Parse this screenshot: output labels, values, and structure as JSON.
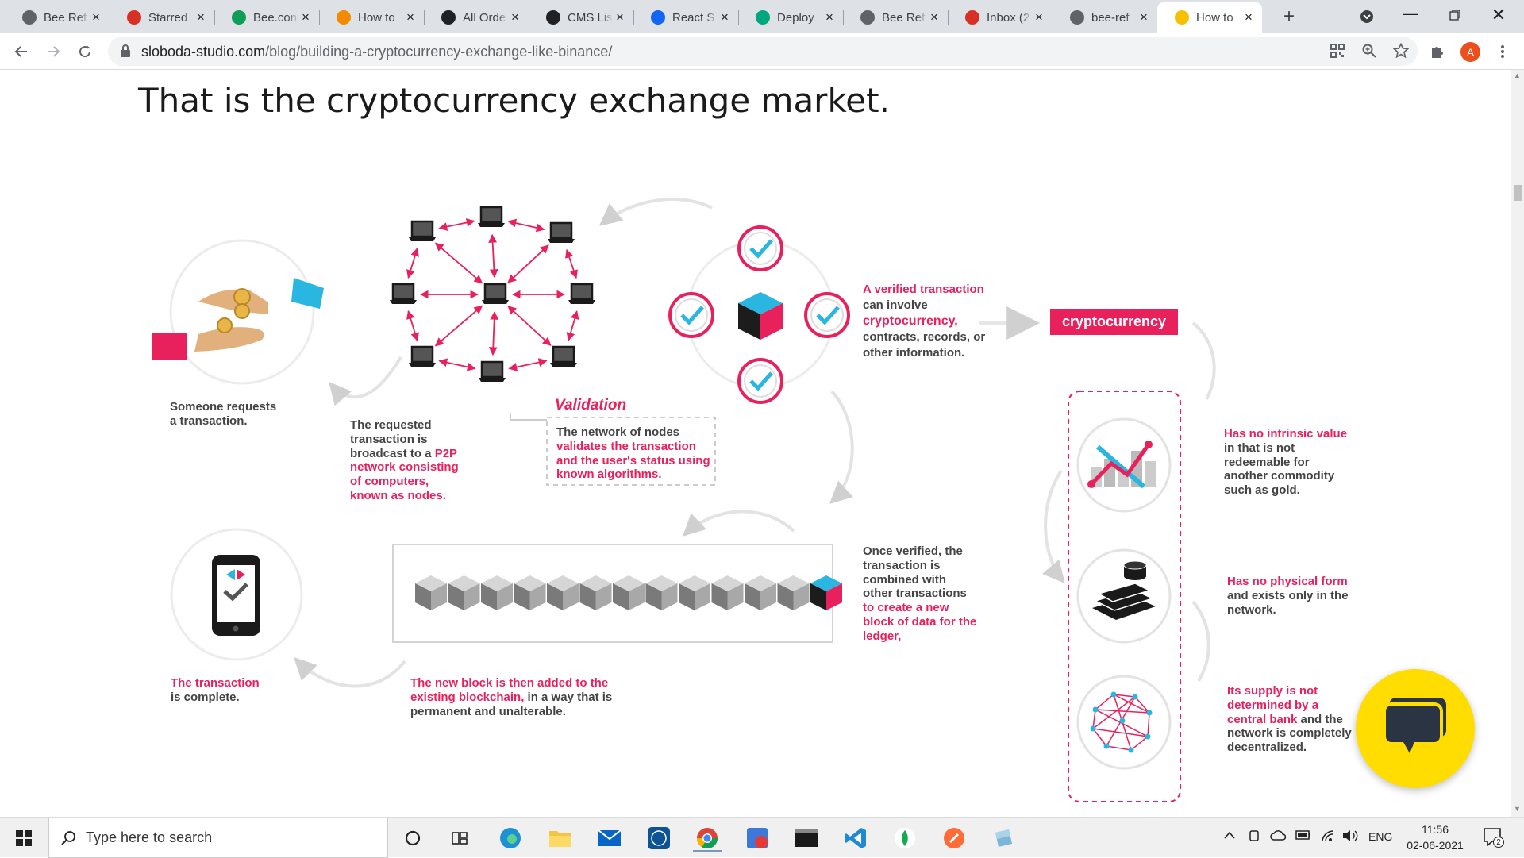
{
  "browser": {
    "tabs": [
      {
        "label": "Bee Ref",
        "icon": "bee-refer-icon",
        "color": "#5f6368"
      },
      {
        "label": "Starred",
        "icon": "gmail-icon",
        "color": "#d93025"
      },
      {
        "label": "Bee.con",
        "icon": "sheets-icon",
        "color": "#0f9d58"
      },
      {
        "label": "How to",
        "icon": "blog-icon",
        "color": "#f28b00"
      },
      {
        "label": "All Orde",
        "icon": "shopify-icon",
        "color": "#202124"
      },
      {
        "label": "CMS Lis",
        "icon": "cms-icon",
        "color": "#202124"
      },
      {
        "label": "React S",
        "icon": "mdb-icon",
        "color": "#1266f1"
      },
      {
        "label": "Deploy",
        "icon": "deploy-icon",
        "color": "#00a67e"
      },
      {
        "label": "Bee Ref",
        "icon": "bee-refer-icon",
        "color": "#5f6368"
      },
      {
        "label": "Inbox (2",
        "icon": "gmail-icon",
        "color": "#d93025"
      },
      {
        "label": "bee-ref",
        "icon": "globe-icon",
        "color": "#5f6368"
      },
      {
        "label": "How to",
        "icon": "sloboda-icon",
        "color": "#f6c000"
      }
    ],
    "active_tab_index": 11,
    "url_domain": "sloboda-studio.com",
    "url_path": "/blog/building-a-cryptocurrency-exchange-like-binance/",
    "profile_initial": "A"
  },
  "page": {
    "heading": "That is the cryptocurrency exchange market.",
    "step1": "Someone requests a transaction.",
    "step2_pre": "The requested transaction is broadcast to a ",
    "step2_pink": "P2P network consisting of computers, known as nodes.",
    "validation_title": "Validation",
    "validation_pre": "The network of nodes ",
    "validation_pink": "validates the transaction and the user's status using known algorithms.",
    "verified_pink": "A verified transaction",
    "verified_mid": "can involve",
    "verified_pink2": "cryptocurrency,",
    "verified_post": "contracts, records, or other information.",
    "crypto_label": "cryptocurrency",
    "once_pre": "Once verified, the transaction is combined with other transactions ",
    "once_pink": "to create a new block of data for the ledger,",
    "newblock_pink": "The new block is then added to the existing blockchain,",
    "newblock_post": "in a way that is permanent and unalterable.",
    "complete_pink": "The transaction",
    "complete_post": "is complete.",
    "prop1_pink": "Has no intrinsic value",
    "prop1_post": "in that is not redeemable for another commodity such as gold.",
    "prop2_pink": "Has no physical form",
    "prop2_post": "and exists only in the network.",
    "prop3_pink": "Its supply is not determined by a central bank",
    "prop3_post": "and the network is completely decentralized."
  },
  "taskbar": {
    "search_placeholder": "Type here to search",
    "language": "ENG",
    "time": "11:56",
    "date": "02-06-2021",
    "notification_count": "2"
  },
  "colors": {
    "accent": "#e8215d",
    "cyan": "#29b6e0",
    "chat": "#ffdd00"
  }
}
